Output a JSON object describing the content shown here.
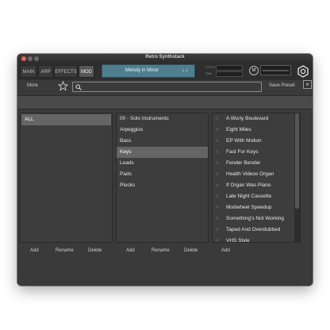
{
  "window": {
    "title": "Retro Synthstack"
  },
  "tabs": [
    {
      "label": "MAIN",
      "active": false
    },
    {
      "label": "ARP",
      "active": false
    },
    {
      "label": "EFFECTS",
      "active": false
    },
    {
      "label": "MOD",
      "active": true
    }
  ],
  "preset": {
    "name": "Melody in Minor",
    "arrows": "‹ ›"
  },
  "meters": {
    "pitch_label": "PITCH",
    "pan_label": "PAN"
  },
  "mod_button": "M",
  "toolbar": {
    "more_label": "More",
    "save_preset_label": "Save Preset",
    "close_label": "×"
  },
  "search": {
    "value": "",
    "placeholder": ""
  },
  "banks": {
    "items": [
      {
        "label": "ALL",
        "selected": true
      }
    ]
  },
  "categories": {
    "items": [
      {
        "label": "00 - Solo Instruments",
        "selected": false
      },
      {
        "label": "Arpeggios",
        "selected": false
      },
      {
        "label": "Bass",
        "selected": false
      },
      {
        "label": "Keys",
        "selected": true
      },
      {
        "label": "Leads",
        "selected": false
      },
      {
        "label": "Pads",
        "selected": false
      },
      {
        "label": "Plucks",
        "selected": false
      }
    ]
  },
  "presets": {
    "star": "☆",
    "items": [
      "A Wurly Boulevard",
      "Eight Miles",
      "EP With Motion",
      "Fast For Keys",
      "Fender Bender",
      "Health Videos Organ",
      "If Organ Was Piano",
      "Late Night Cassette",
      "Modwheel Speedup",
      "Something's Not Working",
      "Taped And Overdubbed",
      "VHS Style"
    ]
  },
  "footer": {
    "banks": {
      "add": "Add",
      "rename": "Rename",
      "delete": "Delete"
    },
    "categories": {
      "add": "Add",
      "rename": "Rename",
      "delete": "Delete"
    },
    "presets": {
      "add": "Add"
    }
  },
  "colors": {
    "accent_display": "#4f7f8e",
    "close_button": "#ee5f57",
    "selection": "#656565"
  }
}
